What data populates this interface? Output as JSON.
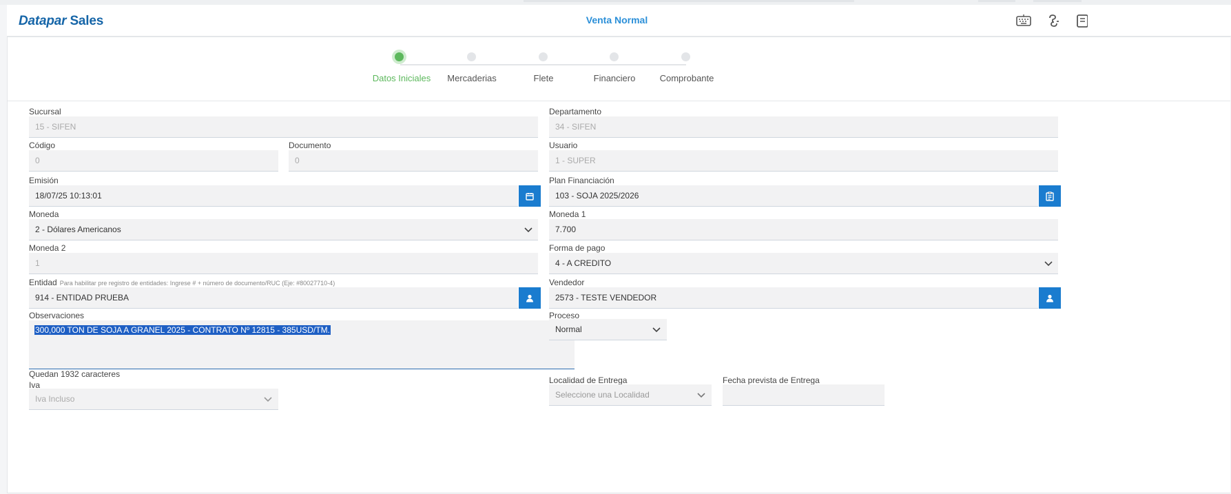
{
  "app": {
    "logo_part1": "Datapar",
    "logo_part2": "Sales",
    "title": "Venta Normal"
  },
  "header_icons": [
    "keyboard-icon",
    "link-icon",
    "document-icon"
  ],
  "steps": [
    {
      "label": "Datos Iniciales",
      "active": true
    },
    {
      "label": "Mercaderias",
      "active": false
    },
    {
      "label": "Flete",
      "active": false
    },
    {
      "label": "Financiero",
      "active": false
    },
    {
      "label": "Comprobante",
      "active": false
    }
  ],
  "form": {
    "sucursal": {
      "label": "Sucursal",
      "value": "15 - SIFEN"
    },
    "departamento": {
      "label": "Departamento",
      "value": "34 - SIFEN"
    },
    "codigo": {
      "label": "Código",
      "value": "0"
    },
    "documento": {
      "label": "Documento",
      "value": "0"
    },
    "usuario": {
      "label": "Usuario",
      "value": "1 - SUPER"
    },
    "emision": {
      "label": "Emisión",
      "value": "18/07/25 10:13:01"
    },
    "plan": {
      "label": "Plan Financiación",
      "value": "103 - SOJA 2025/2026"
    },
    "moneda": {
      "label": "Moneda",
      "value": "2 - Dólares Americanos"
    },
    "moneda1": {
      "label": "Moneda 1",
      "value": "7.700"
    },
    "moneda2": {
      "label": "Moneda 2",
      "value": "1"
    },
    "forma_pago": {
      "label": "Forma de pago",
      "value": "4 - A CREDITO"
    },
    "entidad": {
      "label": "Entidad",
      "hint": "Para habilitar pre registro de entidades: Ingrese # + número de documento/RUC (Eje: #80027710-4)",
      "value": "914 - ENTIDAD PRUEBA"
    },
    "vendedor": {
      "label": "Vendedor",
      "value": "2573 - TESTE VENDEDOR"
    },
    "observaciones": {
      "label": "Observaciones",
      "value": "300,000 TON DE SOJA A GRANEL 2025 -  CONTRATO Nº 12815 - 385USD/TM.",
      "remaining": "Quedan 1932 caracteres"
    },
    "proceso": {
      "label": "Proceso",
      "value": "Normal"
    },
    "iva": {
      "label": "Iva",
      "value": "Iva Incluso"
    },
    "localidad": {
      "label": "Localidad de Entrega",
      "placeholder": "Seleccione una Localidad"
    },
    "fecha_prevista": {
      "label": "Fecha prevista de Entrega",
      "value": ""
    }
  },
  "colors": {
    "accent": "#1a7ccf",
    "active_step": "#5cb85c",
    "title": "#2b8fd8"
  }
}
